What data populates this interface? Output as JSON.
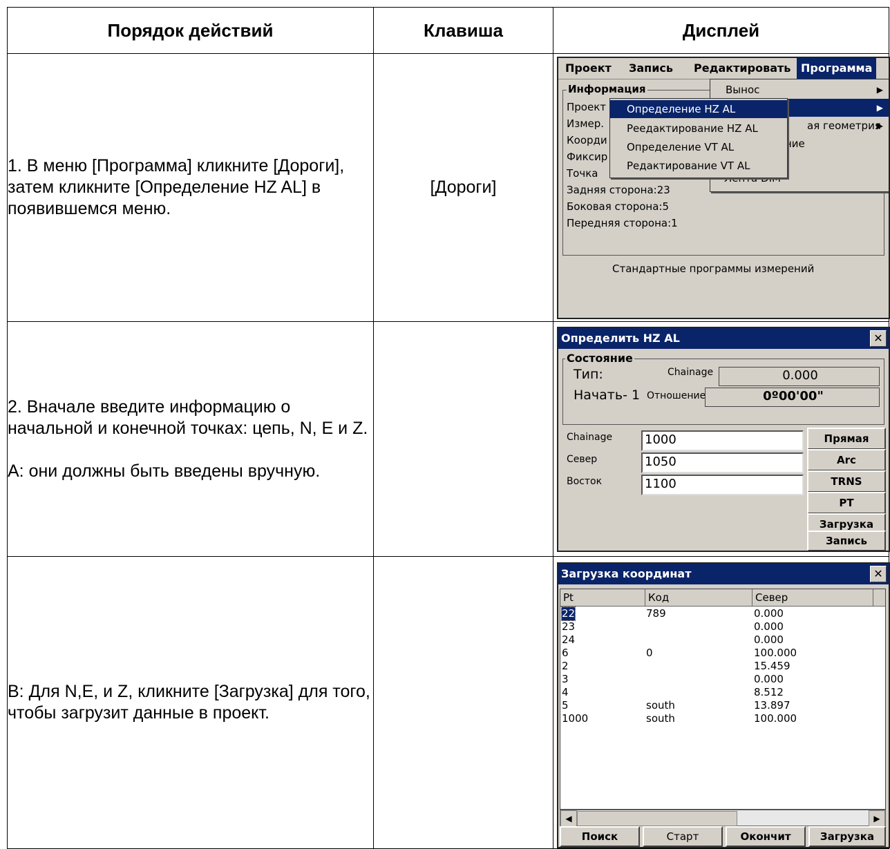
{
  "table": {
    "headers": [
      "Порядок действий",
      "Клавиша",
      "Дисплей"
    ],
    "rows": [
      {
        "step": [
          "1. В меню [Программа] кликните [Дороги], затем кликните [Определение HZ AL] в появившемся меню."
        ],
        "key": "[Дороги]"
      },
      {
        "step": [
          "2. Вначале введите информацию о начальной и конечной точках: цепь, N, E и Z.",
          "A: они должны быть введены вручную."
        ],
        "key": ""
      },
      {
        "step": [
          "B: Для N,E, и Z, кликните [Загрузка] для того, чтобы загрузит данные в проект."
        ],
        "key": ""
      }
    ]
  },
  "screen1": {
    "menu": [
      "Проект",
      "Запись",
      "Редактировать",
      "Программа"
    ],
    "group_label": "Информация",
    "lines": [
      "Проект",
      "Измер.",
      "Коорди",
      "Фиксир",
      "Точка",
      "Задняя сторона:23",
      "Боковая сторона:5",
      "Передняя сторона:1"
    ],
    "footer": "Стандартные программы измерений",
    "popup1": [
      "Вынос",
      "",
      "ая геометрия",
      "ние",
      "",
      "Лента DIM"
    ],
    "popup2": [
      "Определение HZ AL",
      "Реедактирование HZ AL",
      "Определение VT AL",
      "Редактирование VT AL"
    ]
  },
  "screen2": {
    "title": "Определить HZ AL",
    "group_label": "Состояние",
    "type_label": "Тип:",
    "start_label": "Начать- 1",
    "chainage_label": "Chainage",
    "chainage_value": "0.000",
    "ratio_label": "Отношение",
    "ratio_value": "0º00'00\"",
    "inputs": [
      {
        "label": "Chainage",
        "value": "1000"
      },
      {
        "label": "Север",
        "value": "1050"
      },
      {
        "label": "Восток",
        "value": "1100"
      }
    ],
    "buttons": [
      "Прямая",
      "Arc",
      "TRNS",
      "PT",
      "Загрузка",
      "Запись"
    ]
  },
  "screen3": {
    "title": "Загрузка координат",
    "columns": [
      "Pt",
      "Код",
      "Север"
    ],
    "rows": [
      [
        "22",
        "789",
        "0.000"
      ],
      [
        "23",
        "",
        "0.000"
      ],
      [
        "24",
        "",
        "0.000"
      ],
      [
        "6",
        "0",
        "100.000"
      ],
      [
        "2",
        "",
        "15.459"
      ],
      [
        "3",
        "",
        "0.000"
      ],
      [
        "4",
        "",
        "8.512"
      ],
      [
        "5",
        "south",
        "13.897"
      ],
      [
        "1000",
        "south",
        "100.000"
      ]
    ],
    "buttons": [
      "Поиск",
      "Старт",
      "Окончит",
      "Загрузка"
    ]
  }
}
